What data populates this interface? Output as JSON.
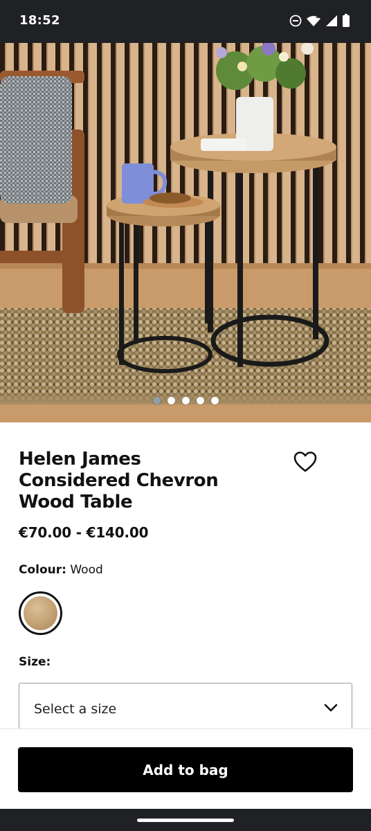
{
  "status_bar": {
    "time": "18:52",
    "icons": [
      "do-not-disturb-icon",
      "wifi-icon",
      "signal-icon",
      "battery-icon"
    ]
  },
  "gallery": {
    "image_count": 5,
    "active_index": 0
  },
  "product": {
    "title": "Helen James Considered Chevron Wood Table",
    "price_range": "€70.00 - €140.00"
  },
  "colour": {
    "label": "Colour:",
    "selected": "Wood",
    "swatch_color": "#c7a679"
  },
  "size": {
    "label": "Size:",
    "placeholder": "Select a size"
  },
  "actions": {
    "add_to_bag": "Add to bag"
  },
  "theme": {
    "button_bg": "#000000",
    "bar_bg": "#202124"
  }
}
